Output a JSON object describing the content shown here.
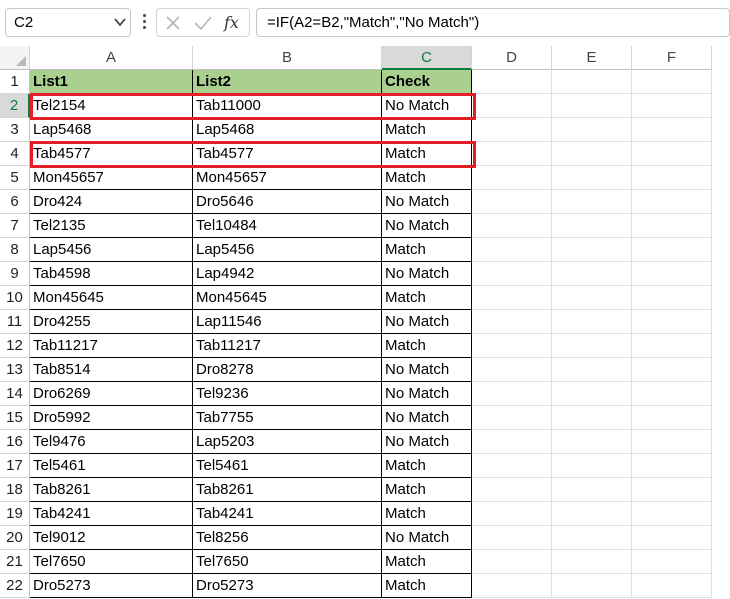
{
  "formula_bar": {
    "name_box": "C2",
    "formula": "=IF(A2=B2,\"Match\",\"No Match\")"
  },
  "columns": [
    "A",
    "B",
    "C",
    "D",
    "E",
    "F"
  ],
  "selected_column": "C",
  "selected_row": 2,
  "header_row": [
    "List1",
    "List2",
    "Check"
  ],
  "rows": [
    [
      "Tel2154",
      "Tab11000",
      "No Match"
    ],
    [
      "Lap5468",
      "Lap5468",
      "Match"
    ],
    [
      "Tab4577",
      "Tab4577",
      "Match"
    ],
    [
      "Mon45657",
      "Mon45657",
      "Match"
    ],
    [
      "Dro424",
      "Dro5646",
      "No Match"
    ],
    [
      "Tel2135",
      "Tel10484",
      "No Match"
    ],
    [
      "Lap5456",
      "Lap5456",
      "Match"
    ],
    [
      "Tab4598",
      "Lap4942",
      "No Match"
    ],
    [
      "Mon45645",
      "Mon45645",
      "Match"
    ],
    [
      "Dro4255",
      "Lap11546",
      "No Match"
    ],
    [
      "Tab11217",
      "Tab11217",
      "Match"
    ],
    [
      "Tab8514",
      "Dro8278",
      "No Match"
    ],
    [
      "Dro6269",
      "Tel9236",
      "No Match"
    ],
    [
      "Dro5992",
      "Tab7755",
      "No Match"
    ],
    [
      "Tel9476",
      "Lap5203",
      "No Match"
    ],
    [
      "Tel5461",
      "Tel5461",
      "Match"
    ],
    [
      "Tab8261",
      "Tab8261",
      "Match"
    ],
    [
      "Tab4241",
      "Tab4241",
      "Match"
    ],
    [
      "Tel9012",
      "Tel8256",
      "No Match"
    ],
    [
      "Tel7650",
      "Tel7650",
      "Match"
    ],
    [
      "Dro5273",
      "Dro5273",
      "Match"
    ]
  ],
  "highlighted_rows": [
    2,
    4
  ],
  "colors": {
    "header_fill": "#a9d08e",
    "highlight_border": "#e41e26",
    "selection": "#107c41"
  }
}
